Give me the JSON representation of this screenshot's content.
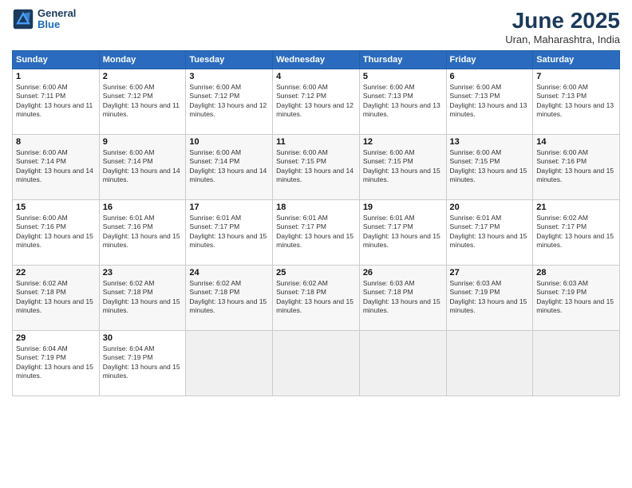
{
  "logo": {
    "line1": "General",
    "line2": "Blue"
  },
  "title": "June 2025",
  "subtitle": "Uran, Maharashtra, India",
  "days_of_week": [
    "Sunday",
    "Monday",
    "Tuesday",
    "Wednesday",
    "Thursday",
    "Friday",
    "Saturday"
  ],
  "weeks": [
    [
      {
        "day": "1",
        "sunrise": "6:00 AM",
        "sunset": "7:11 PM",
        "daylight": "13 hours and 11 minutes."
      },
      {
        "day": "2",
        "sunrise": "6:00 AM",
        "sunset": "7:12 PM",
        "daylight": "13 hours and 11 minutes."
      },
      {
        "day": "3",
        "sunrise": "6:00 AM",
        "sunset": "7:12 PM",
        "daylight": "13 hours and 12 minutes."
      },
      {
        "day": "4",
        "sunrise": "6:00 AM",
        "sunset": "7:12 PM",
        "daylight": "13 hours and 12 minutes."
      },
      {
        "day": "5",
        "sunrise": "6:00 AM",
        "sunset": "7:13 PM",
        "daylight": "13 hours and 13 minutes."
      },
      {
        "day": "6",
        "sunrise": "6:00 AM",
        "sunset": "7:13 PM",
        "daylight": "13 hours and 13 minutes."
      },
      {
        "day": "7",
        "sunrise": "6:00 AM",
        "sunset": "7:13 PM",
        "daylight": "13 hours and 13 minutes."
      }
    ],
    [
      {
        "day": "8",
        "sunrise": "6:00 AM",
        "sunset": "7:14 PM",
        "daylight": "13 hours and 14 minutes."
      },
      {
        "day": "9",
        "sunrise": "6:00 AM",
        "sunset": "7:14 PM",
        "daylight": "13 hours and 14 minutes."
      },
      {
        "day": "10",
        "sunrise": "6:00 AM",
        "sunset": "7:14 PM",
        "daylight": "13 hours and 14 minutes."
      },
      {
        "day": "11",
        "sunrise": "6:00 AM",
        "sunset": "7:15 PM",
        "daylight": "13 hours and 14 minutes."
      },
      {
        "day": "12",
        "sunrise": "6:00 AM",
        "sunset": "7:15 PM",
        "daylight": "13 hours and 15 minutes."
      },
      {
        "day": "13",
        "sunrise": "6:00 AM",
        "sunset": "7:15 PM",
        "daylight": "13 hours and 15 minutes."
      },
      {
        "day": "14",
        "sunrise": "6:00 AM",
        "sunset": "7:16 PM",
        "daylight": "13 hours and 15 minutes."
      }
    ],
    [
      {
        "day": "15",
        "sunrise": "6:00 AM",
        "sunset": "7:16 PM",
        "daylight": "13 hours and 15 minutes."
      },
      {
        "day": "16",
        "sunrise": "6:01 AM",
        "sunset": "7:16 PM",
        "daylight": "13 hours and 15 minutes."
      },
      {
        "day": "17",
        "sunrise": "6:01 AM",
        "sunset": "7:17 PM",
        "daylight": "13 hours and 15 minutes."
      },
      {
        "day": "18",
        "sunrise": "6:01 AM",
        "sunset": "7:17 PM",
        "daylight": "13 hours and 15 minutes."
      },
      {
        "day": "19",
        "sunrise": "6:01 AM",
        "sunset": "7:17 PM",
        "daylight": "13 hours and 15 minutes."
      },
      {
        "day": "20",
        "sunrise": "6:01 AM",
        "sunset": "7:17 PM",
        "daylight": "13 hours and 15 minutes."
      },
      {
        "day": "21",
        "sunrise": "6:02 AM",
        "sunset": "7:17 PM",
        "daylight": "13 hours and 15 minutes."
      }
    ],
    [
      {
        "day": "22",
        "sunrise": "6:02 AM",
        "sunset": "7:18 PM",
        "daylight": "13 hours and 15 minutes."
      },
      {
        "day": "23",
        "sunrise": "6:02 AM",
        "sunset": "7:18 PM",
        "daylight": "13 hours and 15 minutes."
      },
      {
        "day": "24",
        "sunrise": "6:02 AM",
        "sunset": "7:18 PM",
        "daylight": "13 hours and 15 minutes."
      },
      {
        "day": "25",
        "sunrise": "6:02 AM",
        "sunset": "7:18 PM",
        "daylight": "13 hours and 15 minutes."
      },
      {
        "day": "26",
        "sunrise": "6:03 AM",
        "sunset": "7:18 PM",
        "daylight": "13 hours and 15 minutes."
      },
      {
        "day": "27",
        "sunrise": "6:03 AM",
        "sunset": "7:19 PM",
        "daylight": "13 hours and 15 minutes."
      },
      {
        "day": "28",
        "sunrise": "6:03 AM",
        "sunset": "7:19 PM",
        "daylight": "13 hours and 15 minutes."
      }
    ],
    [
      {
        "day": "29",
        "sunrise": "6:04 AM",
        "sunset": "7:19 PM",
        "daylight": "13 hours and 15 minutes."
      },
      {
        "day": "30",
        "sunrise": "6:04 AM",
        "sunset": "7:19 PM",
        "daylight": "13 hours and 15 minutes."
      },
      null,
      null,
      null,
      null,
      null
    ]
  ]
}
